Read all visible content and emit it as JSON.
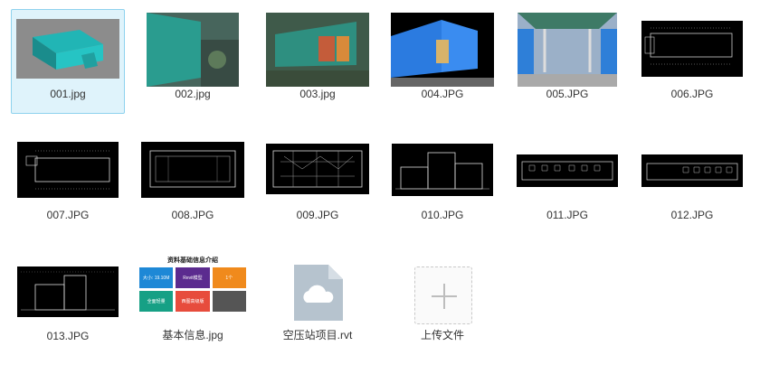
{
  "files": [
    {
      "name": "001.jpg"
    },
    {
      "name": "002.jpg"
    },
    {
      "name": "003.jpg"
    },
    {
      "name": "004.JPG"
    },
    {
      "name": "005.JPG"
    },
    {
      "name": "006.JPG"
    },
    {
      "name": "007.JPG"
    },
    {
      "name": "008.JPG"
    },
    {
      "name": "009.JPG"
    },
    {
      "name": "010.JPG"
    },
    {
      "name": "011.JPG"
    },
    {
      "name": "012.JPG"
    },
    {
      "name": "013.JPG"
    },
    {
      "name": "基本信息.jpg"
    },
    {
      "name": "空压站项目.rvt"
    }
  ],
  "info_card": {
    "title": "资料基础信息介绍",
    "cells": [
      {
        "label": "大小: 19.10M",
        "color": "#1e88d6"
      },
      {
        "label": "Revit模型",
        "color": "#5b2b8f"
      },
      {
        "label": "1个",
        "color": "#f08a1c"
      },
      {
        "label": "全面轻量",
        "color": "#16a085"
      },
      {
        "label": "西图高级版",
        "color": "#e74c3c"
      },
      {
        "label": "",
        "color": "#555555"
      }
    ]
  },
  "upload": {
    "label": "上传文件"
  },
  "colors": {
    "selected_bg": "#dff3fb",
    "selected_border": "#8ed2ee",
    "file_icon": "#b6c3ce"
  }
}
